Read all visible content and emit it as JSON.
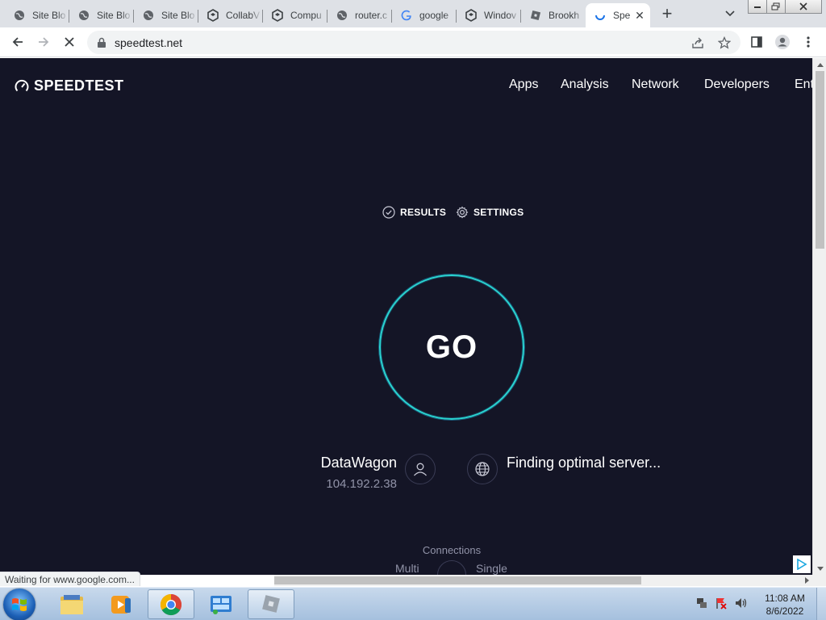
{
  "browser": {
    "tabs": [
      {
        "title": "Site Blo",
        "icon": "globe-icon"
      },
      {
        "title": "Site Blo",
        "icon": "globe-icon"
      },
      {
        "title": "Site Blo",
        "icon": "globe-icon"
      },
      {
        "title": "CollabV",
        "icon": "collabvm-icon"
      },
      {
        "title": "Compu",
        "icon": "collabvm-icon"
      },
      {
        "title": "router.c",
        "icon": "globe-icon"
      },
      {
        "title": "google",
        "icon": "google-icon"
      },
      {
        "title": "Windov",
        "icon": "collabvm-icon"
      },
      {
        "title": "Brookh",
        "icon": "roblox-icon"
      },
      {
        "title": "Spe",
        "icon": "loading-spinner-icon",
        "active": true
      }
    ],
    "new_tab": "+",
    "close_tab": "✕",
    "url": "speedtest.net",
    "status_text": "Waiting for www.google.com..."
  },
  "site": {
    "logo": "SPEEDTEST",
    "nav": [
      "Apps",
      "Analysis",
      "Network",
      "Developers",
      "Ent"
    ],
    "results_label": "RESULTS",
    "settings_label": "SETTINGS",
    "go_label": "GO",
    "isp_name": "DataWagon",
    "isp_ip": "104.192.2.38",
    "server_status": "Finding optimal server...",
    "connections_label": "Connections",
    "connections_multi": "Multi",
    "connections_single": "Single"
  },
  "taskbar": {
    "time": "11:08 AM",
    "date": "8/6/2022"
  },
  "colors": {
    "page_bg": "#141526",
    "go_ring": "#2ad4d0",
    "muted_text": "#9193a8"
  }
}
